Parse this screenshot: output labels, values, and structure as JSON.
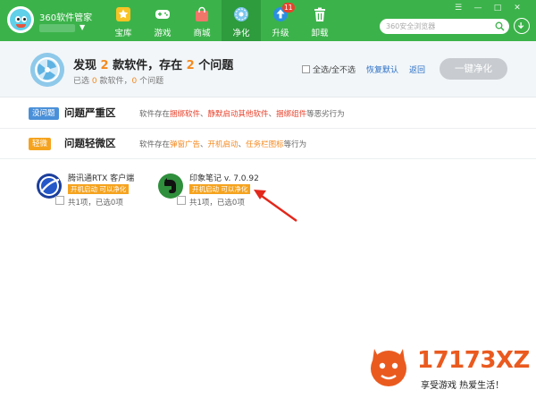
{
  "app": {
    "title": "360软件管家"
  },
  "nav": [
    {
      "label": "宝库",
      "icon": "star-icon"
    },
    {
      "label": "游戏",
      "icon": "gamepad-icon"
    },
    {
      "label": "商城",
      "icon": "shopping-bag-icon"
    },
    {
      "label": "净化",
      "icon": "purify-icon",
      "active": true
    },
    {
      "label": "升级",
      "icon": "upgrade-arrow-icon",
      "badge": "11"
    },
    {
      "label": "卸载",
      "icon": "trash-icon"
    }
  ],
  "window_controls": [
    "☰",
    "—",
    "□",
    "✕"
  ],
  "search": {
    "placeholder": "360安全浏览器"
  },
  "summary": {
    "title_pre": "发现 ",
    "title_num1": "2",
    "title_mid": " 款软件，存在 ",
    "title_num2": "2",
    "title_post": " 个问题",
    "sub_pre": "已选 ",
    "sub_num1": "0",
    "sub_mid": " 款软件，",
    "sub_num2": "0",
    "sub_post": " 个问题",
    "select_all": "全选/全不选",
    "restore": "恢复默认",
    "back": "返回",
    "oneclick": "一键净化"
  },
  "categories": [
    {
      "badge": "没问题",
      "badge_color": "#4a90d9",
      "name": "问题严重区",
      "desc_pre": "软件存在",
      "desc_a": "捆绑软件",
      "desc_sep1": "、",
      "desc_b": "静默启动其他软件",
      "desc_sep2": "、",
      "desc_c": "捆绑组件",
      "desc_post": "等恶劣行为"
    },
    {
      "badge": "轻微",
      "badge_color": "#f5a31f",
      "name": "问题轻微区",
      "desc_pre": "软件存在",
      "desc_a": "弹窗广告",
      "desc_sep1": "、",
      "desc_b": "开机启动",
      "desc_sep2": "、",
      "desc_c": "任务栏图标",
      "desc_post": "等行为"
    }
  ],
  "software": [
    {
      "name": "腾讯通RTX 客户端",
      "tag": "开机启动 可以净化",
      "count": "共1项，已选0项",
      "icon": "rtx-client-icon"
    },
    {
      "name": "印象笔记 v. 7.0.92",
      "tag": "开机启动 可以净化",
      "count": "共1项，已选0项",
      "icon": "evernote-icon"
    }
  ],
  "watermark": {
    "number": "17173XZ",
    "slogan": "享受游戏  热爱生活！"
  },
  "colors": {
    "brand_green": "#3bb34a",
    "active_tab": "#2e9b3d",
    "accent_orange": "#f5891f",
    "warning_red": "#e8432d",
    "link_blue": "#2b6fc5"
  }
}
